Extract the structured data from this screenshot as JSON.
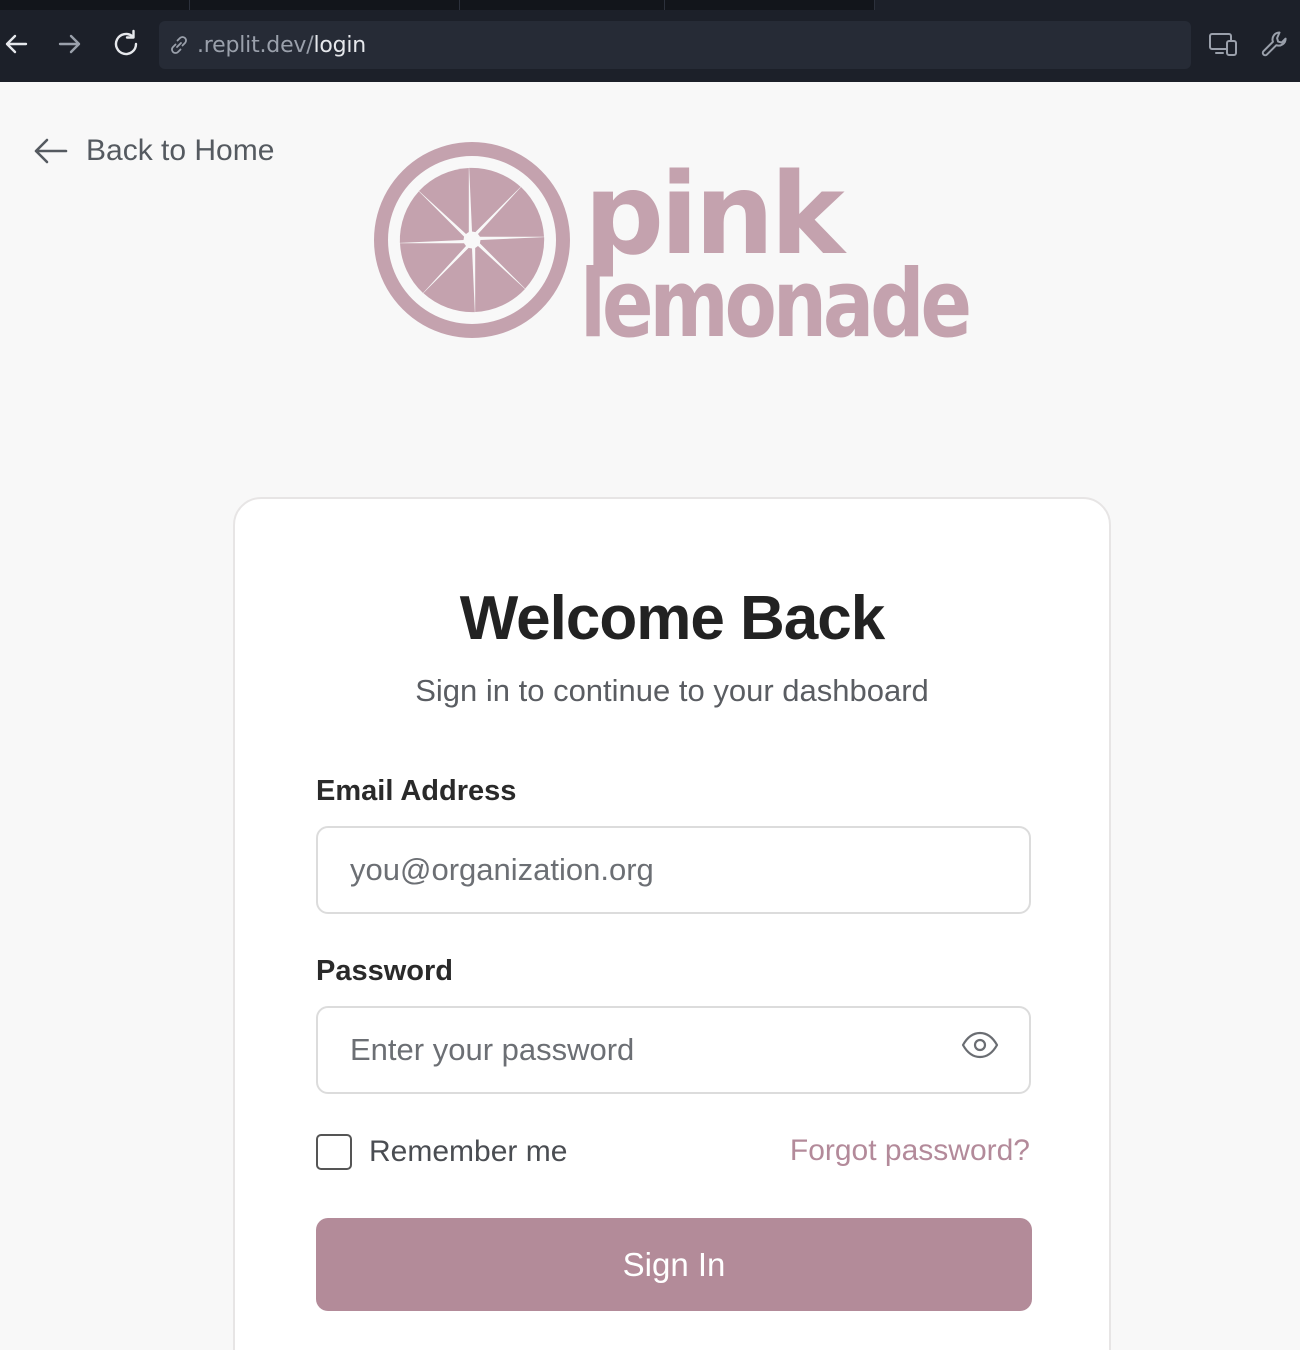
{
  "browser": {
    "url_host": ".replit.dev/",
    "url_path": "login",
    "icons": [
      "back-arrow-icon",
      "forward-arrow-icon",
      "reload-icon",
      "link-icon",
      "devices-icon",
      "wrench-icon"
    ]
  },
  "nav": {
    "back_label": "Back to Home"
  },
  "brand": {
    "logo_line1": "pink",
    "logo_line2": "lemonade",
    "color": "#c4a2ae"
  },
  "login": {
    "title": "Welcome Back",
    "subtitle": "Sign in to continue to your dashboard",
    "email_label": "Email Address",
    "email_placeholder": "you@organization.org",
    "email_value": "",
    "password_label": "Password",
    "password_placeholder": "Enter your password",
    "password_value": "",
    "remember_label": "Remember me",
    "remember_checked": false,
    "forgot_label": "Forgot password?",
    "signin_label": "Sign In",
    "accent_color": "#b38b99"
  }
}
